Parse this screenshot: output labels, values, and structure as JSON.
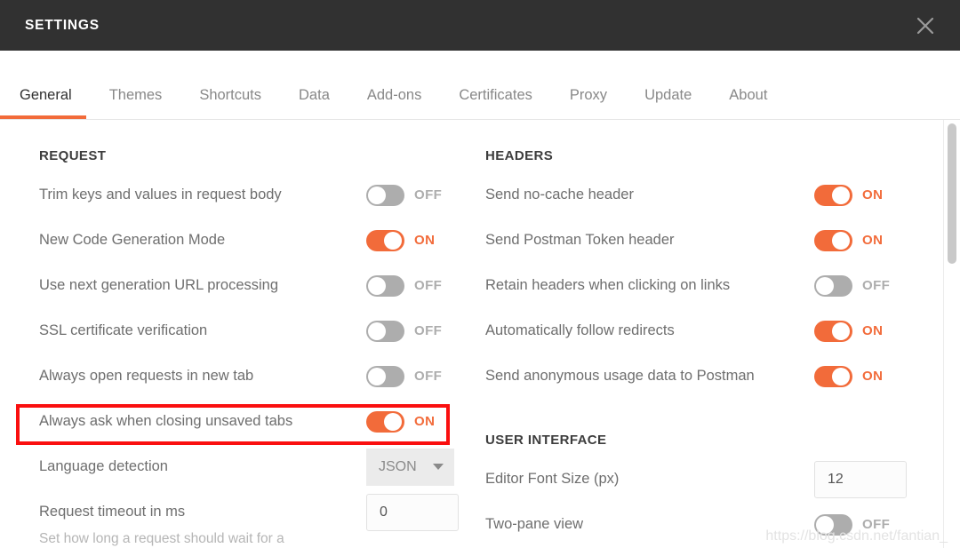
{
  "window": {
    "title": "SETTINGS",
    "close_icon": "close-icon"
  },
  "tabs": [
    {
      "label": "General",
      "active": true
    },
    {
      "label": "Themes",
      "active": false
    },
    {
      "label": "Shortcuts",
      "active": false
    },
    {
      "label": "Data",
      "active": false
    },
    {
      "label": "Add-ons",
      "active": false
    },
    {
      "label": "Certificates",
      "active": false
    },
    {
      "label": "Proxy",
      "active": false
    },
    {
      "label": "Update",
      "active": false
    },
    {
      "label": "About",
      "active": false
    }
  ],
  "left_column": {
    "section_title": "REQUEST",
    "rows": [
      {
        "label": "Trim keys and values in request body",
        "type": "toggle",
        "state": "OFF"
      },
      {
        "label": "New Code Generation Mode",
        "type": "toggle",
        "state": "ON"
      },
      {
        "label": "Use next generation URL processing",
        "type": "toggle",
        "state": "OFF"
      },
      {
        "label": "SSL certificate verification",
        "type": "toggle",
        "state": "OFF"
      },
      {
        "label": "Always open requests in new tab",
        "type": "toggle",
        "state": "OFF"
      },
      {
        "label": "Always ask when closing unsaved tabs",
        "type": "toggle",
        "state": "ON"
      },
      {
        "label": "Language detection",
        "type": "select",
        "value": "JSON"
      },
      {
        "label": "Request timeout in ms",
        "type": "input",
        "value": "0"
      }
    ],
    "timeout_help": "Set how long a request should wait for a"
  },
  "right_column": {
    "headers_title": "HEADERS",
    "headers_rows": [
      {
        "label": "Send no-cache header",
        "type": "toggle",
        "state": "ON"
      },
      {
        "label": "Send Postman Token header",
        "type": "toggle",
        "state": "ON"
      },
      {
        "label": "Retain headers when clicking on links",
        "type": "toggle",
        "state": "OFF"
      },
      {
        "label": "Automatically follow redirects",
        "type": "toggle",
        "state": "ON"
      },
      {
        "label": "Send anonymous usage data to Postman",
        "type": "toggle",
        "state": "ON"
      }
    ],
    "ui_title": "USER INTERFACE",
    "ui_rows": [
      {
        "label": "Editor Font Size (px)",
        "type": "input",
        "value": "12"
      },
      {
        "label": "Two-pane view",
        "type": "toggle",
        "state": "OFF"
      }
    ]
  },
  "watermark": "https://blog.csdn.net/fantian_",
  "colors": {
    "accent": "#f26b3a",
    "titlebar": "#313131",
    "highlight": "#fa0f0f",
    "toggle_off": "#adadad"
  }
}
